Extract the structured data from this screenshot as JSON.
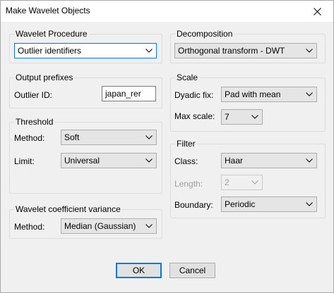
{
  "window": {
    "title": "Make Wavelet Objects"
  },
  "wavelet_procedure": {
    "group_label": "Wavelet Procedure",
    "selected": "Outlier identifiers"
  },
  "output_prefixes": {
    "group_label": "Output prefixes",
    "outlier_id_label": "Outlier ID:",
    "outlier_id_value": "japan_rer"
  },
  "threshold": {
    "group_label": "Threshold",
    "method_label": "Method:",
    "method_value": "Soft",
    "limit_label": "Limit:",
    "limit_value": "Universal"
  },
  "variance": {
    "group_label": "Wavelet coefficient variance",
    "method_label": "Method:",
    "method_value": "Median (Gaussian)"
  },
  "decomposition": {
    "group_label": "Decomposition",
    "selected": "Orthogonal transform - DWT"
  },
  "scale": {
    "group_label": "Scale",
    "dyadic_label": "Dyadic fix:",
    "dyadic_value": "Pad with mean",
    "max_label": "Max scale:",
    "max_value": "7"
  },
  "filter": {
    "group_label": "Filter",
    "class_label": "Class:",
    "class_value": "Haar",
    "length_label": "Length:",
    "length_value": "2",
    "boundary_label": "Boundary:",
    "boundary_value": "Periodic"
  },
  "buttons": {
    "ok": "OK",
    "cancel": "Cancel"
  },
  "icons": {
    "close": "close-icon",
    "dropdown": "chevron-down-icon"
  },
  "colors": {
    "focus_border": "#0078d7",
    "window_bg": "#f0f0f0"
  }
}
